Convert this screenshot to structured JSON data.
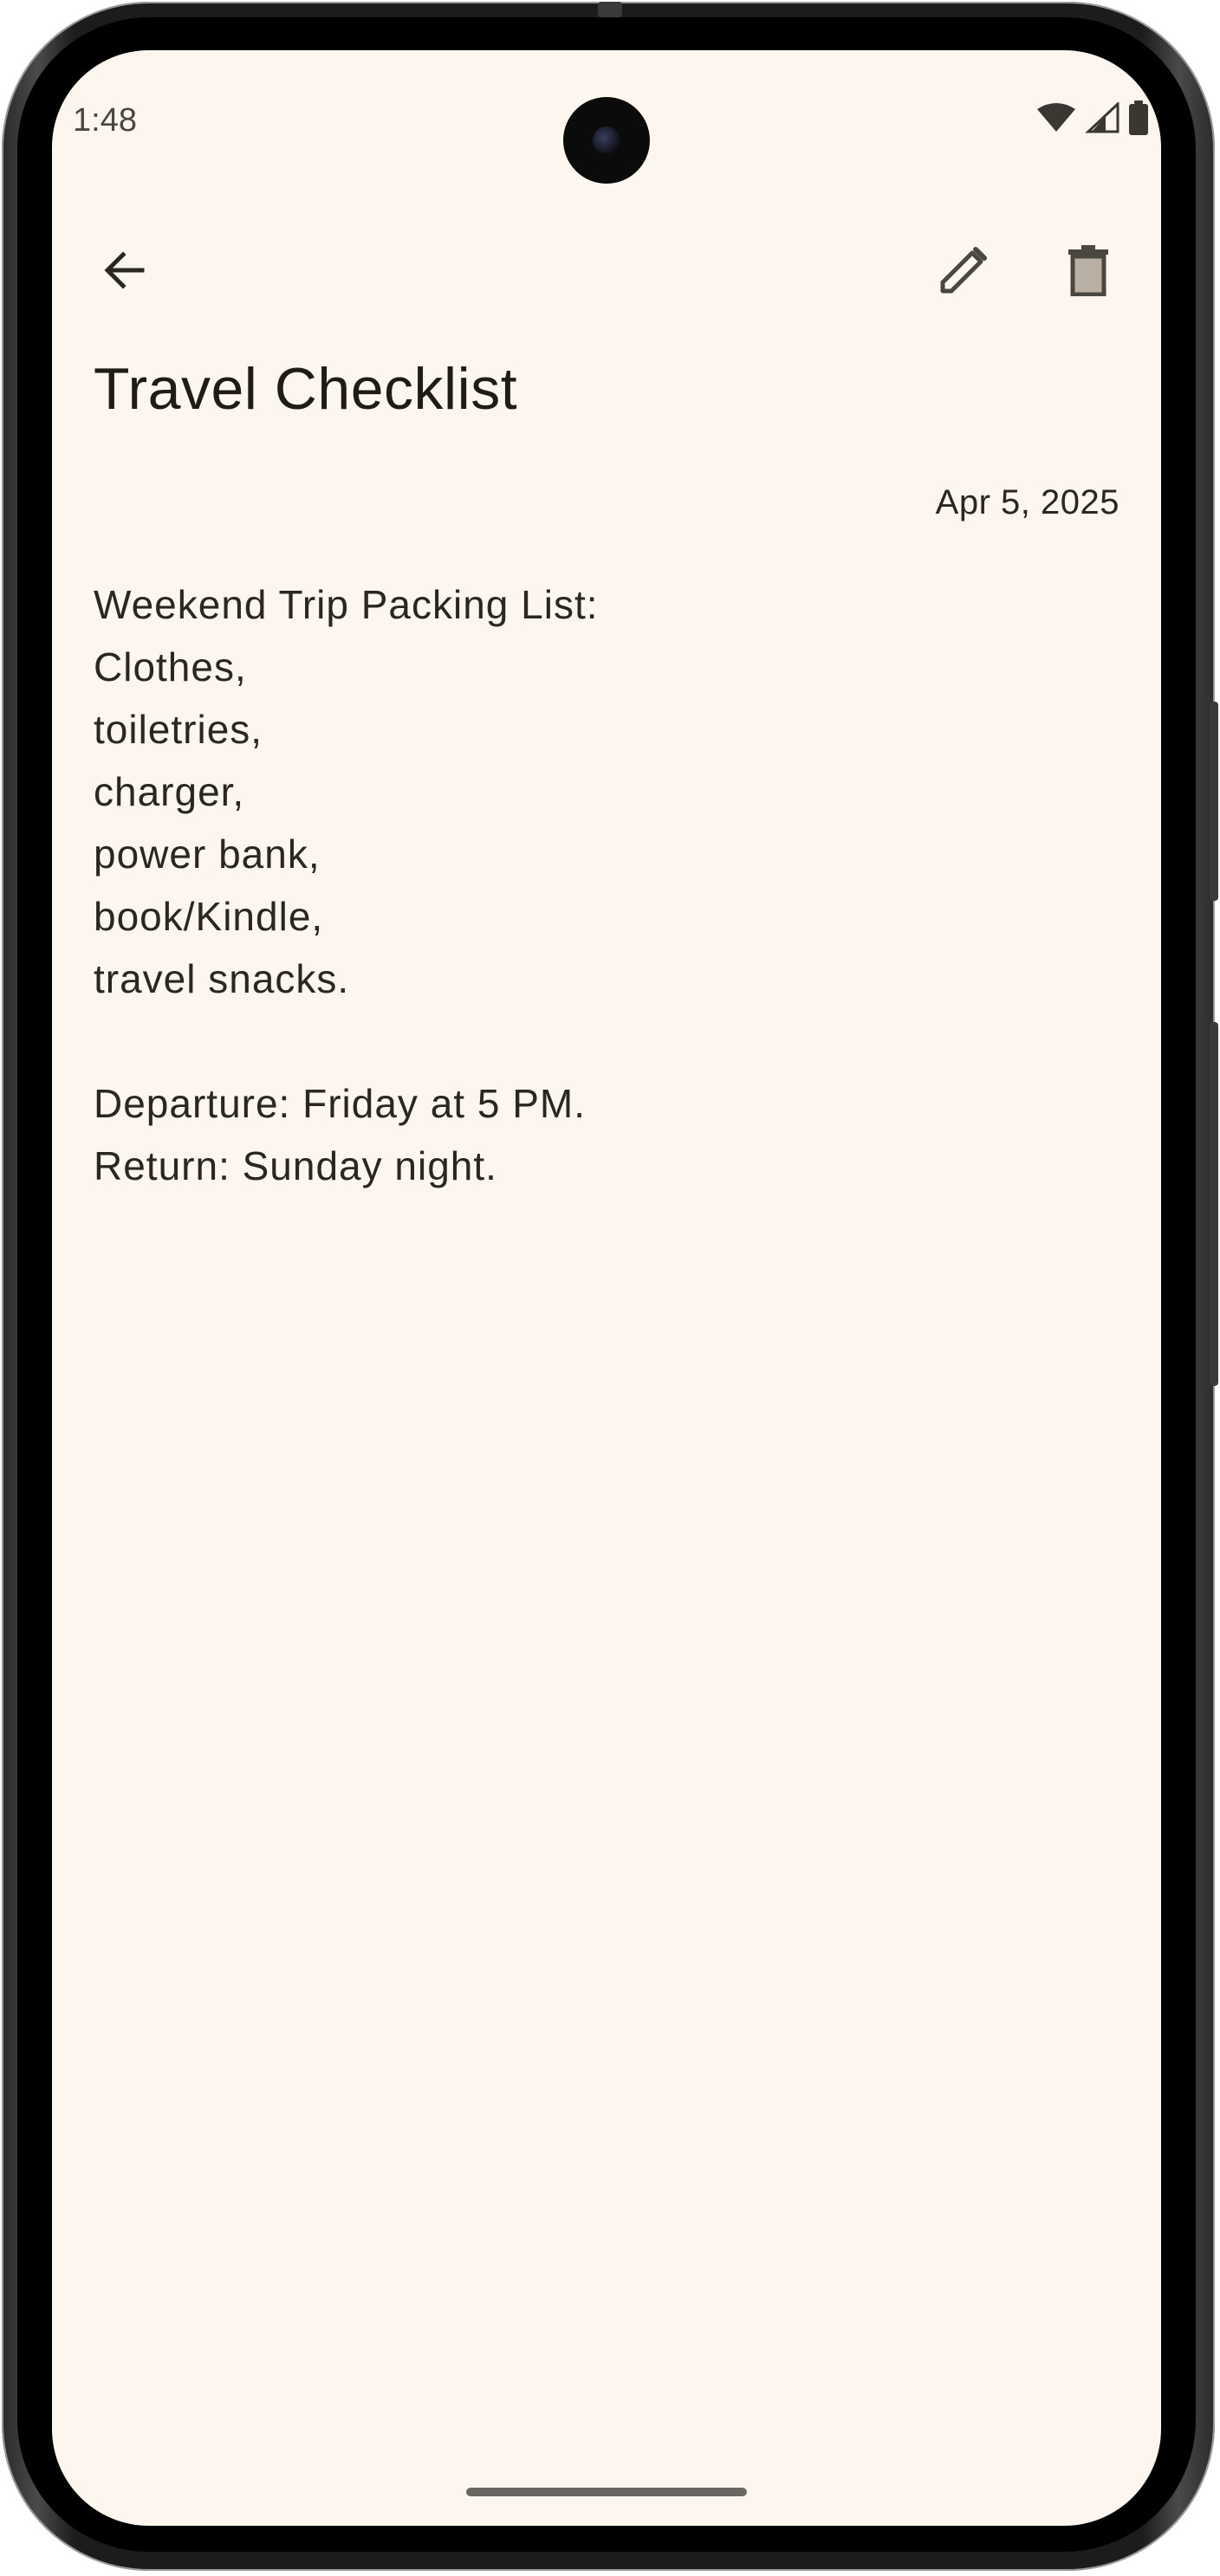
{
  "status_bar": {
    "time": "1:48",
    "icons": [
      "wifi-icon",
      "cell-signal-icon",
      "battery-icon"
    ]
  },
  "app_bar": {
    "back_icon": "arrow-back-icon",
    "edit_icon": "pencil-icon",
    "delete_icon": "trash-icon"
  },
  "note": {
    "title": "Travel Checklist",
    "date": "Apr 5, 2025",
    "body": "Weekend Trip Packing List:\nClothes,\ntoiletries,\ncharger,\npower bank,\nbook/Kindle,\ntravel snacks.\n\nDeparture: Friday at 5 PM.\nReturn: Sunday night."
  },
  "colors": {
    "background": "#fcf6ef",
    "text": "#2a2722",
    "icon": "#4a4640"
  }
}
